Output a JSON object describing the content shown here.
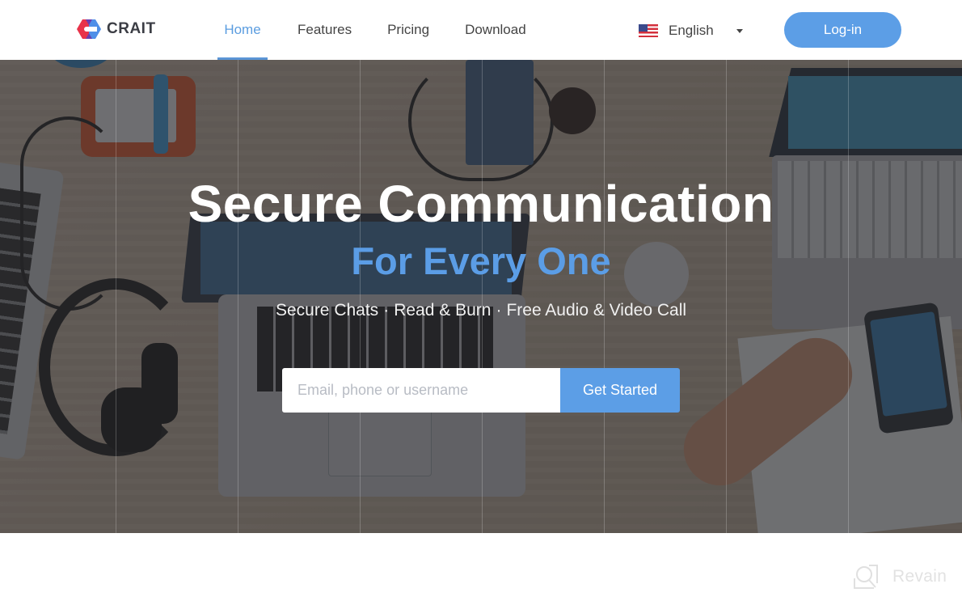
{
  "header": {
    "logo": {
      "text": "CRAIT",
      "icon": "crait-hexagon-logo-icon"
    },
    "nav": [
      {
        "label": "Home",
        "active": true
      },
      {
        "label": "Features",
        "active": false
      },
      {
        "label": "Pricing",
        "active": false
      },
      {
        "label": "Download",
        "active": false
      }
    ],
    "language": {
      "label": "English",
      "flag_icon": "us-flag-icon",
      "caret_icon": "caret-down-icon"
    },
    "login_label": "Log-in"
  },
  "hero": {
    "headline": "Secure Communication",
    "subheadline": "For Every One",
    "features": [
      "Secure Chats",
      "Read & Burn",
      "Free Audio & Video Call"
    ],
    "feature_separator": "·",
    "signup": {
      "placeholder": "Email, phone or username",
      "value": "",
      "button_label": "Get Started"
    }
  },
  "watermark": {
    "text": "Revain",
    "icon": "revain-logo-icon"
  },
  "colors": {
    "accent": "#5c9ee6",
    "active_nav": "#5b9de0",
    "nav_text": "#444444",
    "headline": "#ffffff",
    "subheadline": "#5b9de6",
    "logo_red": "#e8334a",
    "logo_purple": "#6a3fb0",
    "logo_blue": "#4f8fe8"
  }
}
